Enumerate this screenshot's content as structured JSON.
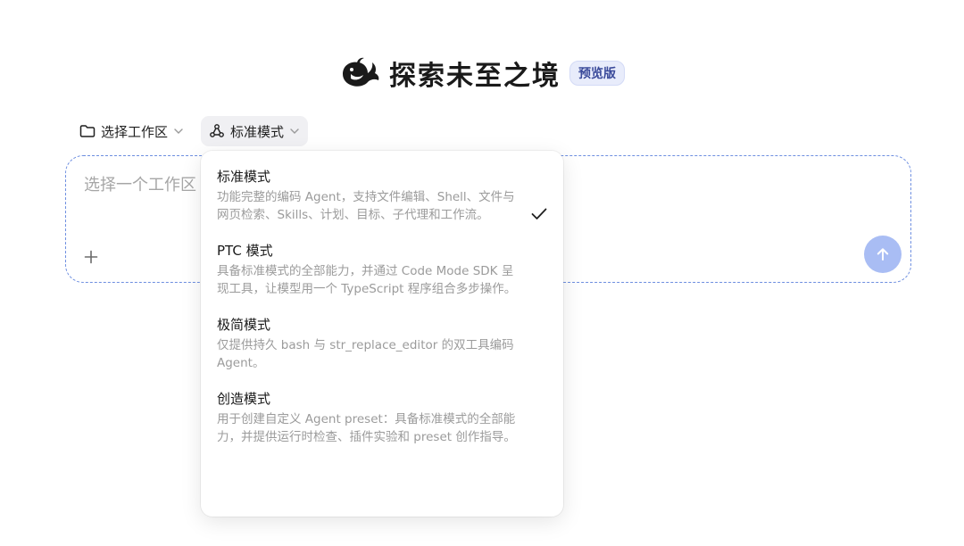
{
  "header": {
    "title": "探索未至之境",
    "badge": "预览版",
    "logo_icon": "whale-logo-icon"
  },
  "toolbar": {
    "workspace_label": "选择工作区",
    "mode_label": "标准模式"
  },
  "composer": {
    "placeholder": "选择一个工作区"
  },
  "mode_menu": {
    "selected_index": 0,
    "items": [
      {
        "title": "标准模式",
        "description": "功能完整的编码 Agent，支持文件编辑、Shell、文件与网页检索、Skills、计划、目标、子代理和工作流。",
        "selected": true
      },
      {
        "title": "PTC 模式",
        "description": "具备标准模式的全部能力，并通过 Code Mode SDK 呈现工具，让模型用一个 TypeScript 程序组合多步操作。",
        "selected": false
      },
      {
        "title": "极简模式",
        "description": "仅提供持久 bash 与 str_replace_editor 的双工具编码 Agent。",
        "selected": false
      },
      {
        "title": "创造模式",
        "description": "用于创建自定义 Agent preset：具备标准模式的全部能力，并提供运行时检查、插件实验和 preset 创作指导。",
        "selected": false
      }
    ]
  },
  "colors": {
    "accent_border": "#6d8ee0",
    "send_button": "#a9bdf4",
    "badge_bg": "#e8ecfb",
    "badge_text": "#3a4a9a"
  }
}
